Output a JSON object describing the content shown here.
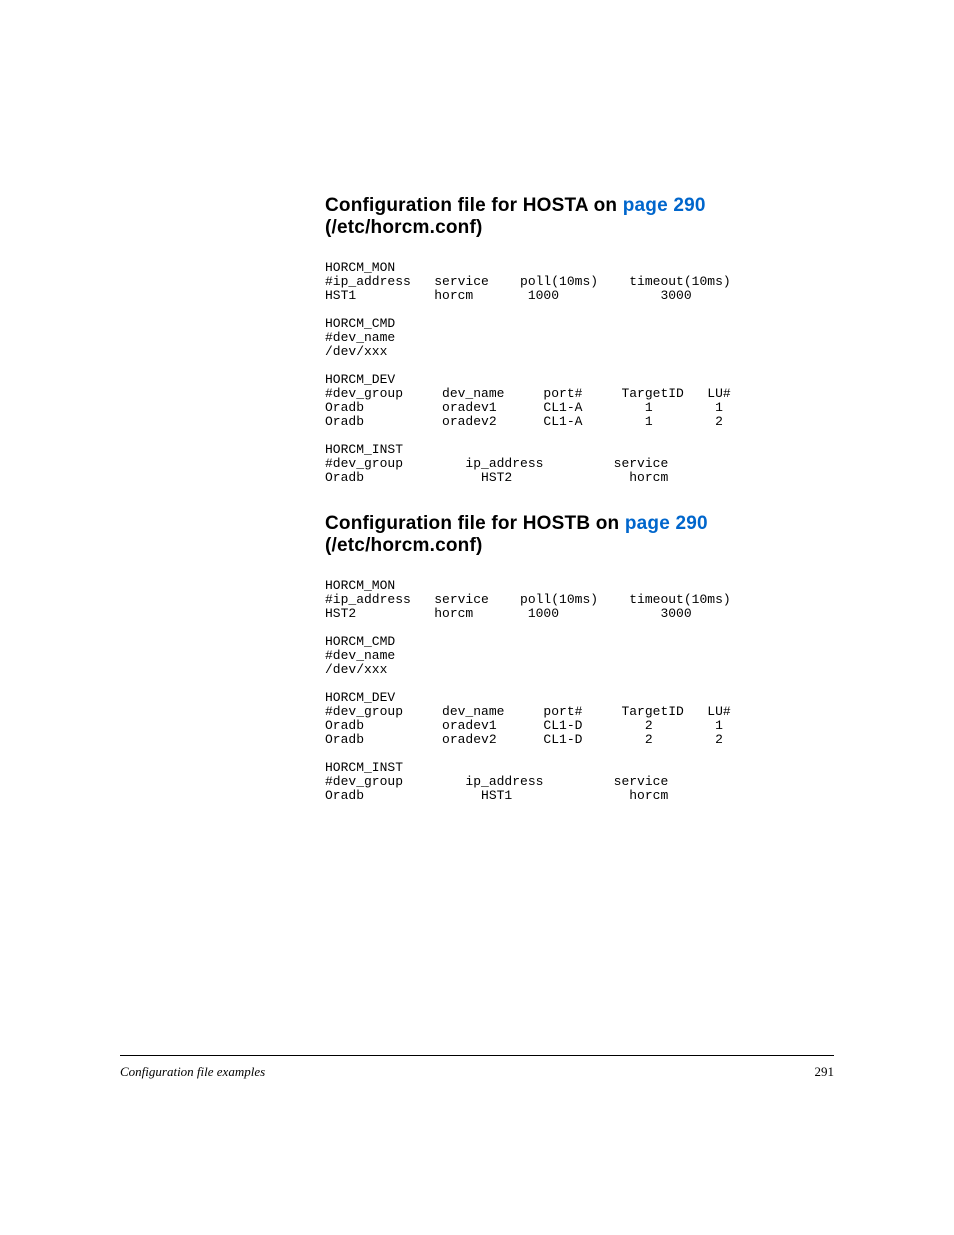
{
  "sections": [
    {
      "heading_pre": "Configuration file for HOSTA on ",
      "heading_link": "page 290",
      "heading_post": " (/etc/horcm.conf)",
      "code": "HORCM_MON\n#ip_address   service    poll(10ms)    timeout(10ms)\nHST1          horcm       1000             3000\n\nHORCM_CMD\n#dev_name\n/dev/xxx\n\nHORCM_DEV\n#dev_group     dev_name     port#     TargetID   LU#\nOradb          oradev1      CL1-A        1        1\nOradb          oradev2      CL1-A        1        2\n\nHORCM_INST\n#dev_group        ip_address         service\nOradb               HST2               horcm"
    },
    {
      "heading_pre": "Configuration file for HOSTB on ",
      "heading_link": "page 290",
      "heading_post": " (/etc/horcm.conf)",
      "code": "HORCM_MON\n#ip_address   service    poll(10ms)    timeout(10ms)\nHST2          horcm       1000             3000\n\nHORCM_CMD\n#dev_name\n/dev/xxx\n\nHORCM_DEV\n#dev_group     dev_name     port#     TargetID   LU#\nOradb          oradev1      CL1-D        2        1\nOradb          oradev2      CL1-D        2        2\n\nHORCM_INST\n#dev_group        ip_address         service\nOradb               HST1               horcm"
    }
  ],
  "footer": {
    "title": "Configuration file examples",
    "page_number": "291"
  }
}
